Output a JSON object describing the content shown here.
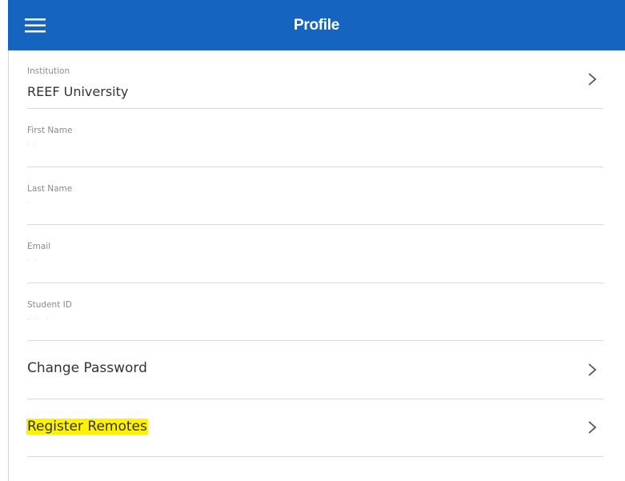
{
  "header": {
    "title": "Profile",
    "menu_icon": "hamburger-icon",
    "background_color": "#1565c0"
  },
  "profile": {
    "institution": {
      "label": "Institution",
      "value": "REEF University"
    },
    "first_name": {
      "label": "First Name",
      "value": "· ·"
    },
    "last_name": {
      "label": "Last Name",
      "value": "·"
    },
    "email": {
      "label": "Email",
      "value": "· ·"
    },
    "student_id": {
      "label": "Student ID",
      "value": "- ·· ·"
    }
  },
  "actions": {
    "change_password": {
      "label": "Change Password"
    },
    "register_remotes": {
      "label": "Register Remotes",
      "highlight_color": "#fff200"
    }
  }
}
